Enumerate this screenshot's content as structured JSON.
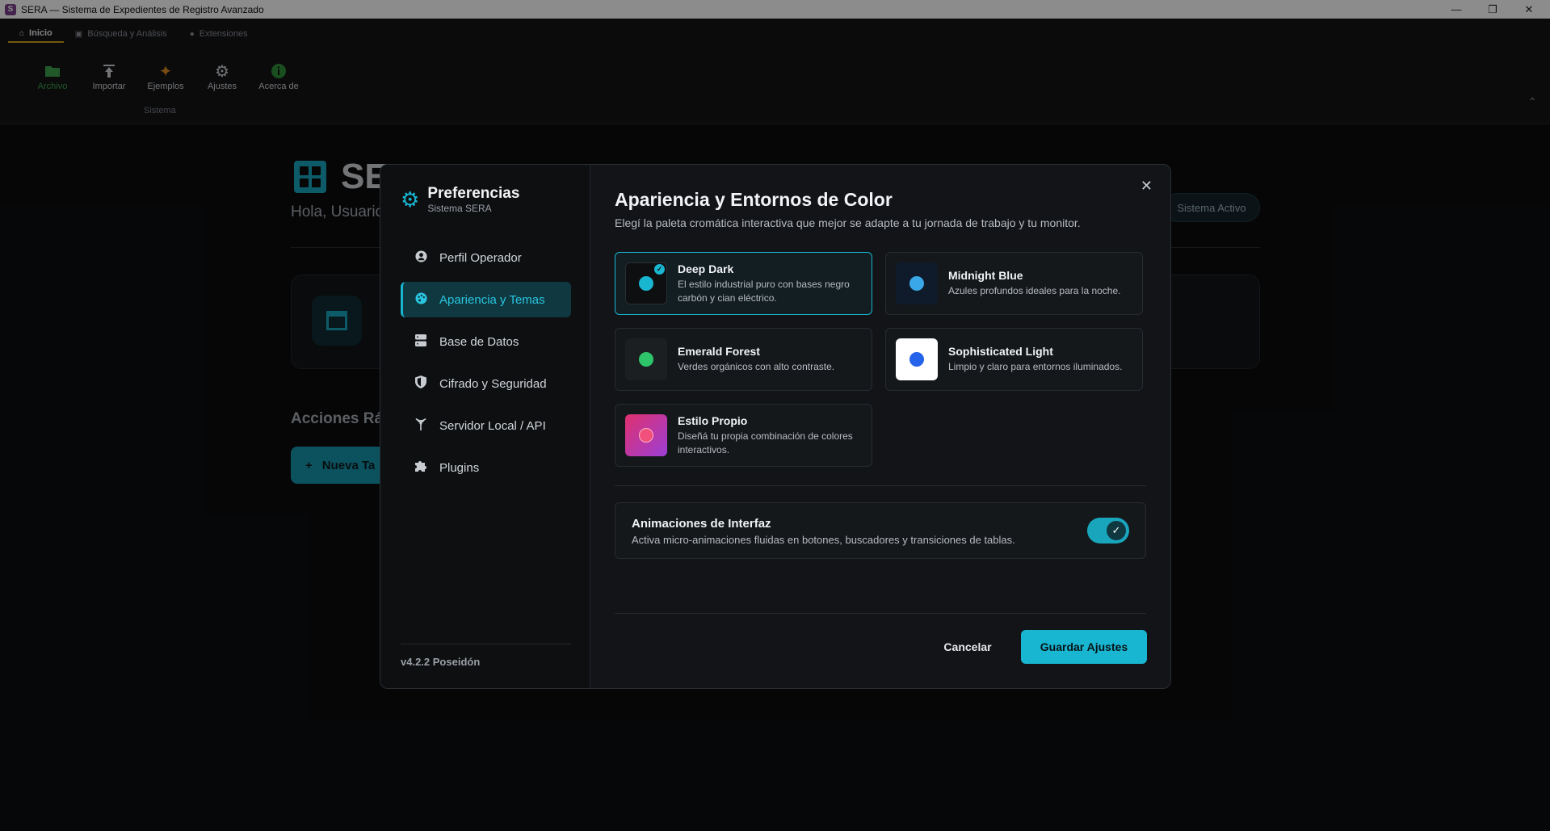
{
  "window": {
    "title": "SERA — Sistema de Expedientes de Registro Avanzado",
    "icon": "sera-app-icon",
    "controls": [
      "minimize",
      "restore",
      "close"
    ]
  },
  "ribbon": {
    "tabs": [
      {
        "label": "Inicio",
        "icon": "home-icon",
        "active": true
      },
      {
        "label": "Búsqueda y Análisis",
        "icon": "chart-icon",
        "active": false
      },
      {
        "label": "Extensiones",
        "icon": "plug-icon",
        "active": false
      }
    ],
    "buttons": [
      {
        "label": "Archivo",
        "icon": "folder-icon",
        "color": "#3fa34d"
      },
      {
        "label": "Importar",
        "icon": "upload-icon",
        "color": "#cfd3d8"
      },
      {
        "label": "Ejemplos",
        "icon": "sparkle-icon",
        "color": "#d98a1e"
      },
      {
        "label": "Ajustes",
        "icon": "gear-icon",
        "color": "#cfd3d8"
      },
      {
        "label": "Acerca de",
        "icon": "info-icon",
        "color": "#2f8f3a"
      }
    ],
    "group_label": "Sistema"
  },
  "background": {
    "title": "SE",
    "greeting": "Hola, Usuario",
    "status": "Sistema Activo",
    "quick_actions": "Acciones Ráp",
    "new_button": "Nueva Ta"
  },
  "preferences": {
    "title": "Preferencias",
    "subtitle": "Sistema SERA",
    "nav": [
      {
        "label": "Perfil Operador",
        "icon": "user-icon"
      },
      {
        "label": "Apariencia y Temas",
        "icon": "palette-icon",
        "active": true
      },
      {
        "label": "Base de Datos",
        "icon": "database-icon"
      },
      {
        "label": "Cifrado y Seguridad",
        "icon": "shield-icon"
      },
      {
        "label": "Servidor Local / API",
        "icon": "broadcast-icon"
      },
      {
        "label": "Plugins",
        "icon": "puzzle-icon"
      }
    ],
    "version": "v4.2.2 Poseidón"
  },
  "appearance": {
    "title": "Apariencia y Entornos de Color",
    "subtitle": "Elegí la paleta cromática interactiva que mejor se adapte a tu jornada de trabajo y tu monitor.",
    "themes": [
      {
        "name": "Deep Dark",
        "desc": "El estilo industrial puro con bases negro carbón y cian eléctrico.",
        "swatch_bg": "#0d0f11",
        "dot": "#19b6d1",
        "selected": true
      },
      {
        "name": "Midnight Blue",
        "desc": "Azules profundos ideales para la noche.",
        "swatch_bg": "#0f1a2b",
        "dot": "#3aa8e8",
        "selected": false
      },
      {
        "name": "Emerald Forest",
        "desc": "Verdes orgánicos con alto contraste.",
        "swatch_bg": "#1b1f22",
        "dot": "#2ec46a",
        "selected": false
      },
      {
        "name": "Sophisticated Light",
        "desc": "Limpio y claro para entornos iluminados.",
        "swatch_bg": "#ffffff",
        "dot": "#2563eb",
        "selected": false
      },
      {
        "name": "Estilo Propio",
        "desc": "Diseñá tu propia combinación de colores interactivos.",
        "swatch_bg": "linear-gradient(135deg,#e0306e,#9b3fd6)",
        "dot": "#f0507a",
        "selected": false
      }
    ],
    "animations": {
      "title": "Animaciones de Interfaz",
      "desc": "Activa micro-animaciones fluidas en botones, buscadores y transiciones de tablas.",
      "enabled": true
    },
    "cancel_label": "Cancelar",
    "save_label": "Guardar Ajustes"
  },
  "colors": {
    "accent": "#19b6d1",
    "background": "#0b0c0e"
  }
}
